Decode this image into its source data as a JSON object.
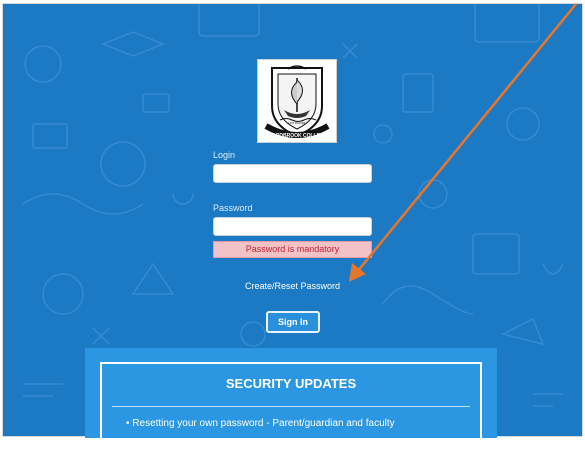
{
  "logo": {
    "caption": "WOODBROOK COLLEGE",
    "motto": "LUX DOCET"
  },
  "login_form": {
    "login_label": "Login",
    "login_value": "",
    "password_label": "Password",
    "password_value": "",
    "error_message": "Password is mandatory",
    "reset_link": "Create/Reset Password",
    "signin_label": "Sign In"
  },
  "security": {
    "title": "SECURITY UPDATES",
    "items": [
      "Resetting your own password - Parent/guardian and faculty"
    ]
  },
  "annotation": {
    "arrow_color": "#e8762a",
    "arrow_icon": "arrow-icon"
  },
  "colors": {
    "background": "#1c79c4",
    "error_bg": "#f2c2c7",
    "error_text": "#c4232f",
    "panel": "#2b97e3"
  }
}
